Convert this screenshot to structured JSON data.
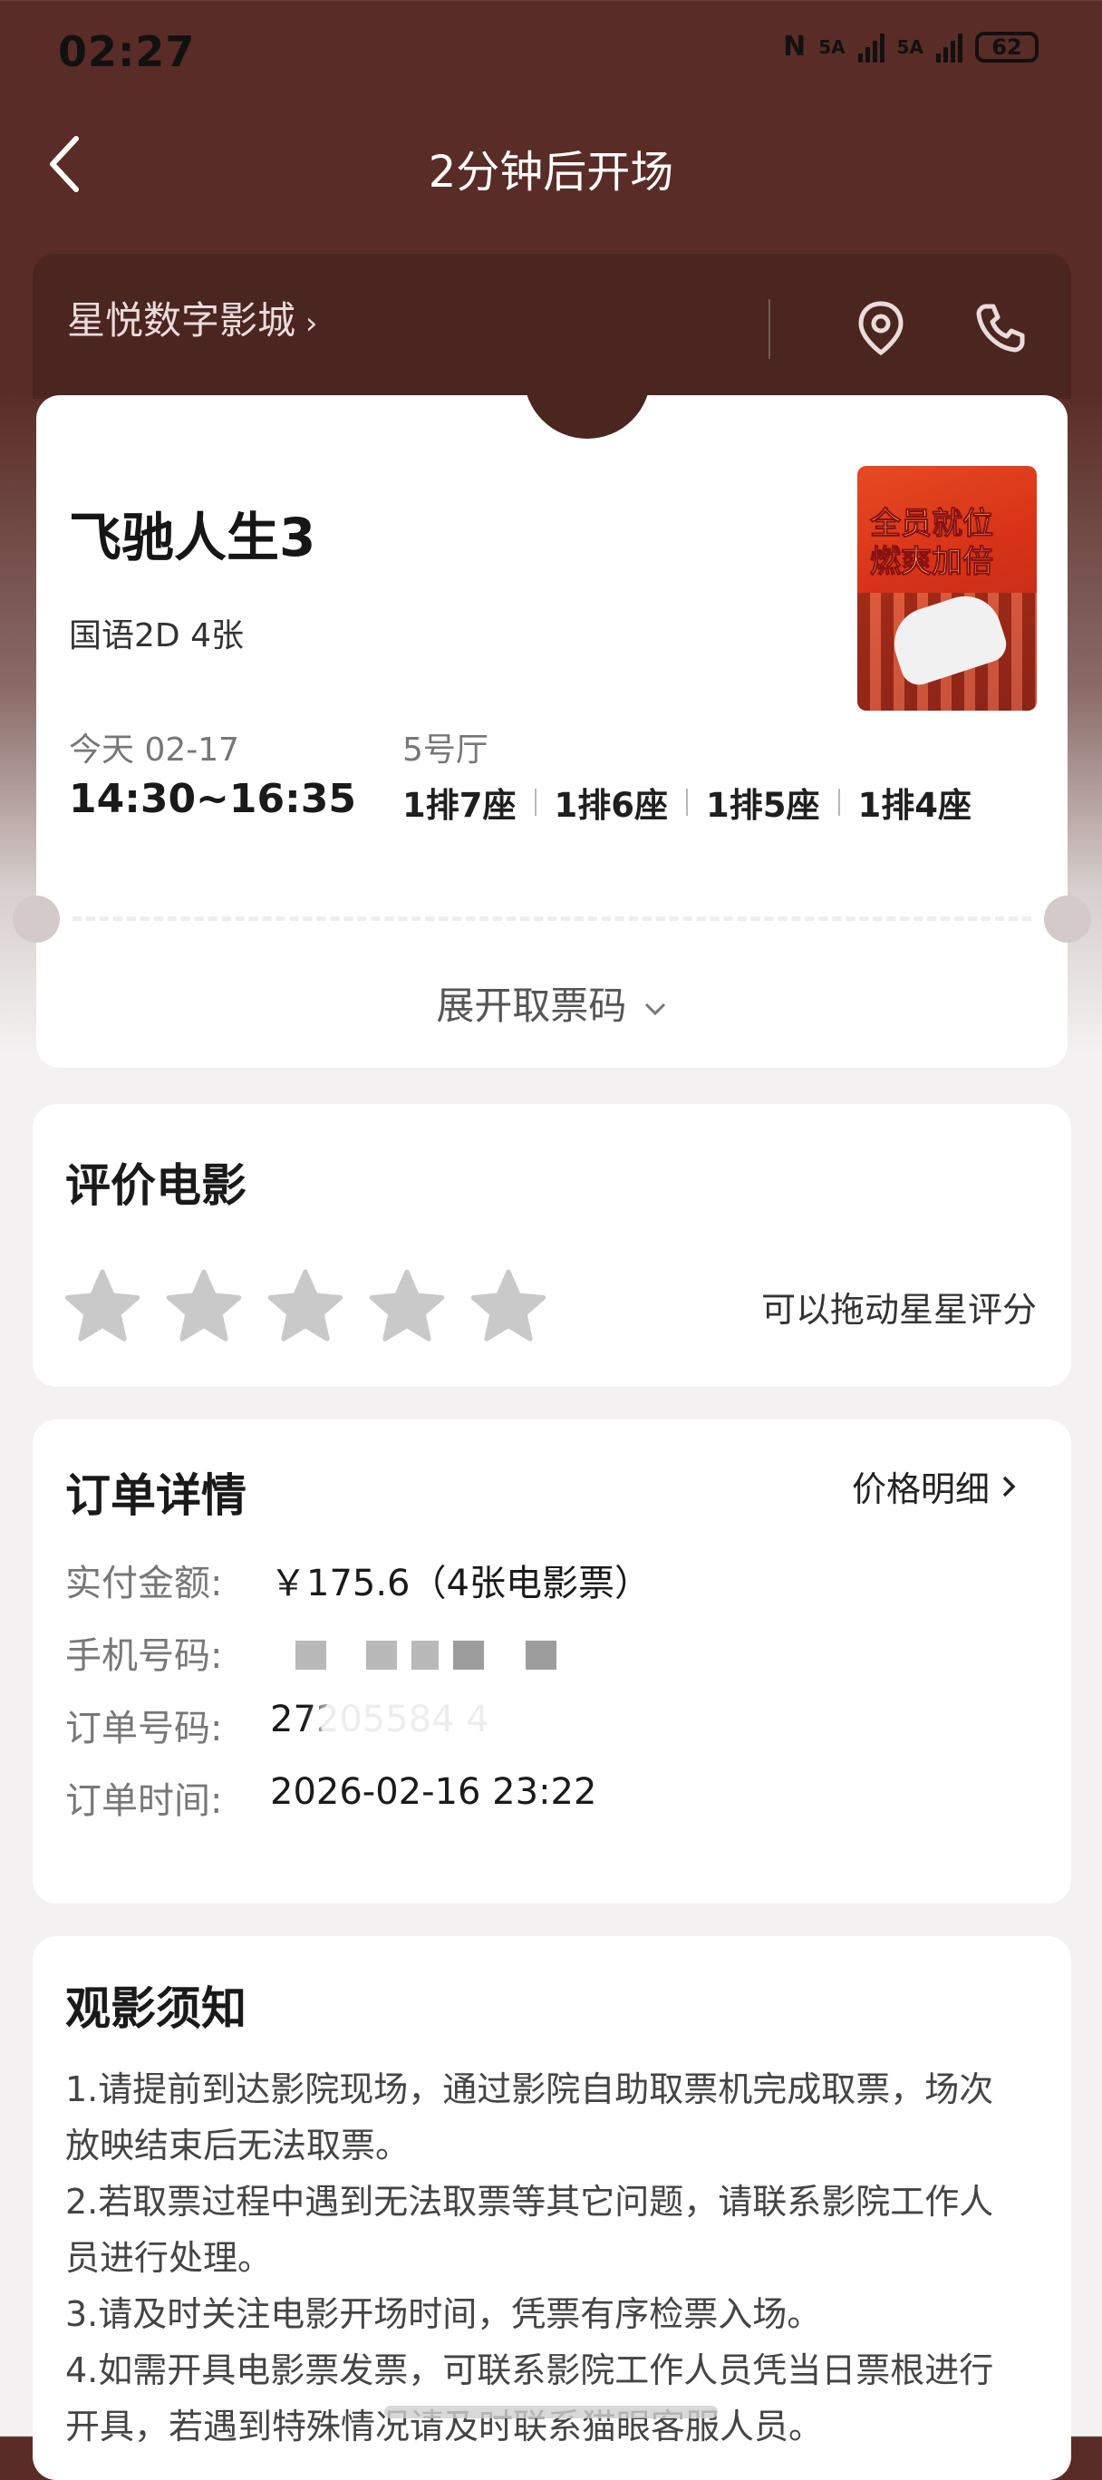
{
  "status_bar": {
    "time": "02:27",
    "nfc": "N",
    "signal1": "5A",
    "signal2": "5A",
    "battery": "62"
  },
  "nav": {
    "title": "2分钟后开场",
    "back_icon": "chevron-left-icon"
  },
  "cinema": {
    "name": "星悦数字影城",
    "location_icon": "location-pin-icon",
    "phone_icon": "phone-icon"
  },
  "ticket": {
    "movie_title": "飞驰人生3",
    "meta": "国语2D 4张",
    "poster_text_line1": "全员就位",
    "poster_text_line2": "燃爽加倍",
    "date_label": "今天 02-17",
    "time_range": "14:30~16:35",
    "hall": "5号厅",
    "seats": [
      "1排7座",
      "1排6座",
      "1排5座",
      "1排4座"
    ],
    "expand_code_label": "展开取票码"
  },
  "rating": {
    "title": "评价电影",
    "stars_total": 5,
    "stars_selected": 0,
    "hint": "可以拖动星星评分"
  },
  "order": {
    "title": "订单详情",
    "price_detail_label": "价格明细",
    "amount_label": "实付金额:",
    "amount_value": "￥175.6（4张电影票）",
    "phone_label": "手机号码:",
    "order_no_label": "订单号码:",
    "order_no_value": "27205584 4",
    "order_time_label": "订单时间:",
    "order_time_value": "2026-02-16 23:22"
  },
  "notice": {
    "title": "观影须知",
    "items": [
      "1.请提前到达影院现场，通过影院自助取票机完成取票，场次放映结束后无法取票。",
      "2.若取票过程中遇到无法取票等其它问题，请联系影院工作人员进行处理。",
      "3.请及时关注电影开场时间，凭票有序检票入场。",
      "4.如需开具电影票发票，可联系影院工作人员凭当日票根进行开具，若遇到特殊情况请及时联系猫眼客服人员。"
    ]
  }
}
